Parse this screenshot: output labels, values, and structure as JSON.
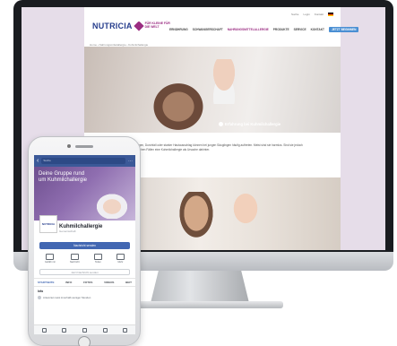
{
  "website": {
    "logo_word": "NUTRICIA",
    "logo_tagline": "FÜR KLEINE FÜR DIE WELT",
    "utility": [
      "Suche",
      "Login",
      "Kontakt"
    ],
    "nav": [
      "ERNÄHRUNG",
      "SCHWANGERSCHAFT",
      "NAHRUNGSMITTELALLERGIE",
      "PRODUKTE",
      "SERVICE",
      "KONTAKT"
    ],
    "nav_active_index": 2,
    "cta": "JETZT BEGINNEN",
    "breadcrumb": "Home › Nahrungsmittelallergie › Kuhmilchallergie",
    "hero_caption": "Erfahrung bei Kuhmilchallergie",
    "body_text": "Beschwerden wie Blähungen, Durchfall oder starker Hautausschlag können bei jungen Säuglingen häufig auftreten. Meist sind sie harmlos. Sind sie jedoch ausgeprägt, steckt in manchen Fällen eine Kuhmilchallergie als Ursache dahinter."
  },
  "facebook": {
    "search_placeholder": "Suche",
    "cover_text": "Deine Gruppe rund um Kuhmilchallergie",
    "page_name": "Kuhmilchallergie",
    "page_sub": "Gemeinschaft",
    "follow_button": "Nachricht senden",
    "actions": [
      "Gefällt mir",
      "Nachricht",
      "Teilen",
      "Mehr"
    ],
    "message_field": "Jetzt Nachricht senden",
    "tabs": [
      "STARTSEITE",
      "INFO",
      "FOTOS",
      "VIDEOS",
      "BEIT"
    ],
    "active_tab_index": 0,
    "post_title": "Info",
    "post_line": "Antwortet meist innerhalb weniger Stunden"
  },
  "colors": {
    "screen_background": "#e6dde9",
    "nutricia_blue": "#263d8c",
    "nutricia_purple": "#9b2d82",
    "facebook_blue": "#3b5998"
  }
}
